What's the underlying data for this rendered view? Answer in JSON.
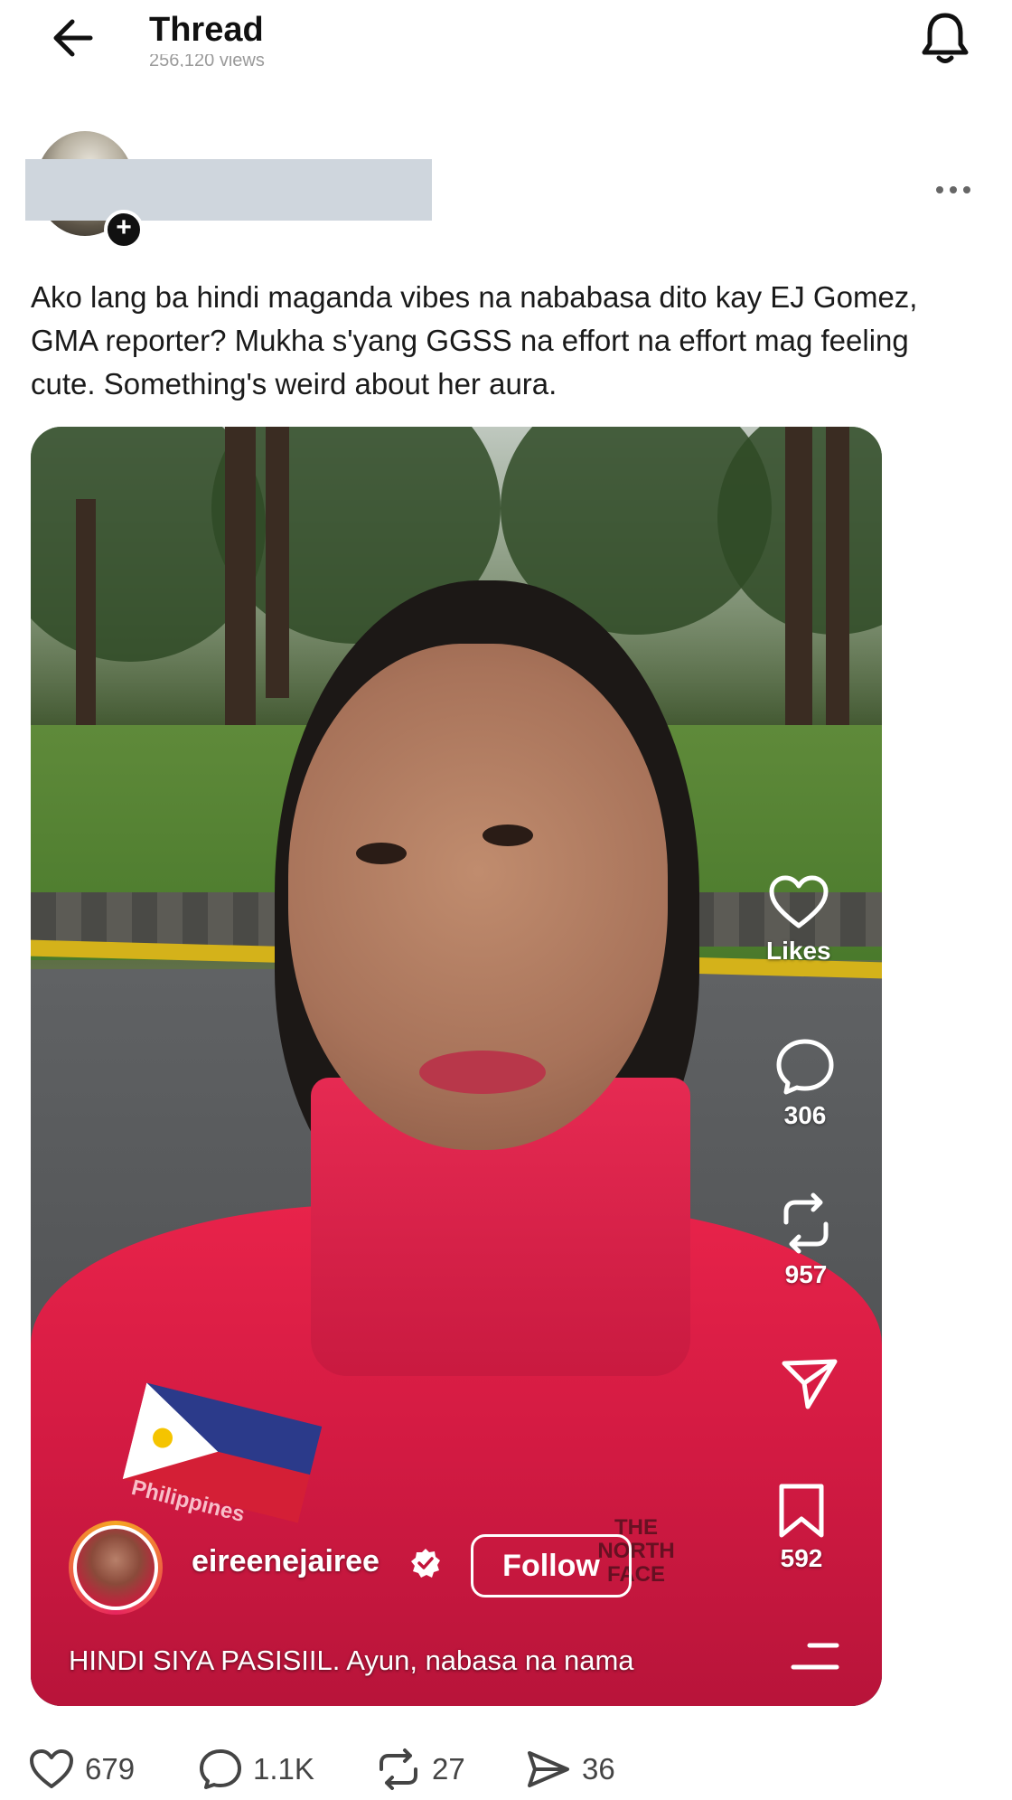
{
  "header": {
    "title": "Thread",
    "subtitle": "256,120 views",
    "back_icon": "arrow-left-icon",
    "notification_icon": "bell-icon"
  },
  "author": {
    "more_icon": "more-horizontal-icon",
    "follow_plus": "+"
  },
  "post": {
    "text": "Ako lang ba hindi maganda vibes na nababasa dito kay EJ Gomez, GMA reporter? Mukha s'yang GGSS na effort na effort mag feeling cute. Something's weird about her aura."
  },
  "media": {
    "side_actions": [
      {
        "icon": "heart-icon",
        "label": "Likes"
      },
      {
        "icon": "comment-icon",
        "label": "306"
      },
      {
        "icon": "repost-icon",
        "label": "957"
      },
      {
        "icon": "send-icon",
        "label": ""
      },
      {
        "icon": "bookmark-icon",
        "label": "592"
      }
    ],
    "username": "eireenejairee",
    "follow_label": "Follow",
    "caption": "HINDI SIYA PASISIIL. Ayun, nabasa na nama",
    "jacket_text": "Philippines",
    "jacket_brand": "THE NORTH FACE"
  },
  "actions": {
    "likes": "679",
    "replies": "1.1K",
    "reposts": "27",
    "shares": "36"
  },
  "colors": {
    "jacket_red": "#d21a42",
    "background": "#ffffff",
    "action_gray": "#444444"
  }
}
